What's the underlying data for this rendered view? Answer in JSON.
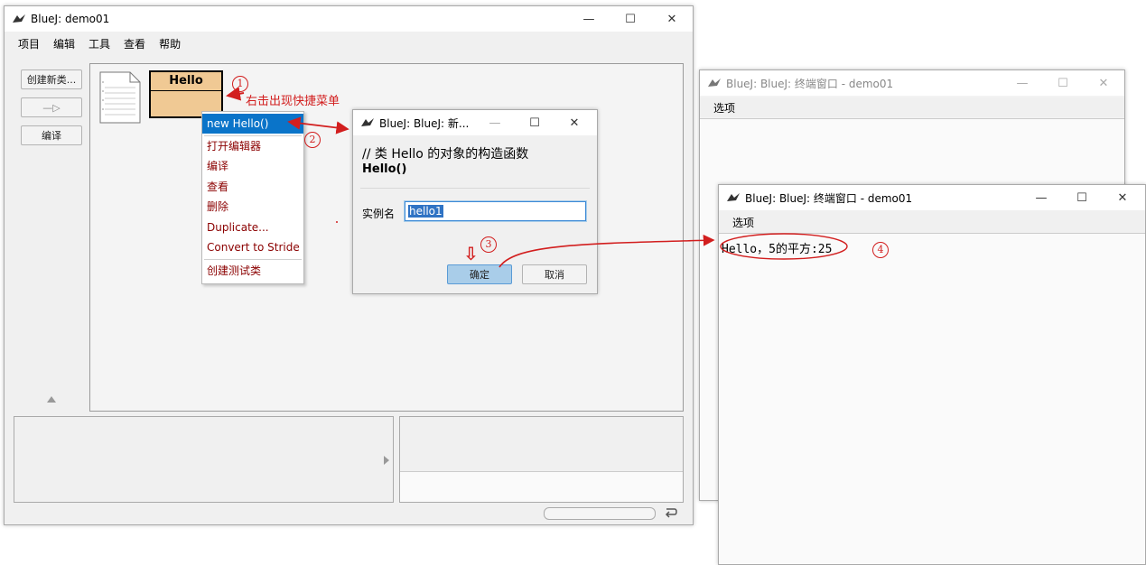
{
  "main_window": {
    "title": "BlueJ:  demo01",
    "menu": [
      "项目",
      "编辑",
      "工具",
      "查看",
      "帮助"
    ],
    "buttons": {
      "new_class": "创建新类...",
      "arrow": "—▷",
      "compile": "编译"
    },
    "class_box": {
      "name": "Hello"
    },
    "controls": {
      "minimize": "—",
      "maximize": "☐",
      "close": "✕"
    }
  },
  "context_menu": {
    "items": [
      "new Hello()",
      "打开编辑器",
      "编译",
      "查看",
      "删除",
      "Duplicate...",
      "Convert to Stride",
      "创建测试类"
    ],
    "selected_index": 0
  },
  "dialog": {
    "title": "BlueJ:  BlueJ:  新...",
    "comment": "// 类 Hello 的对象的构造函数",
    "signature": "Hello()",
    "field_label": "实例名",
    "field_value": "hello1",
    "ok_label": "确定",
    "cancel_label": "取消"
  },
  "terminal_back": {
    "title": "BlueJ: BlueJ:  终端窗口 - demo01",
    "menu": "选项"
  },
  "terminal_front": {
    "title": "BlueJ: BlueJ:  终端窗口 - demo01",
    "menu": "选项",
    "output": "Hello，5的平方:25"
  },
  "annotations": {
    "note1": "右击出现快捷菜单",
    "n1": "1",
    "n2": "2",
    "n3": "3",
    "n4": "4",
    "down_arrow": "⇩"
  },
  "colors": {
    "annotation_red": "#d21e1e",
    "class_fill": "#f0c994",
    "menu_select": "#0a74c9",
    "menu_text": "#8b0000",
    "ok_button": "#a9cde9"
  }
}
